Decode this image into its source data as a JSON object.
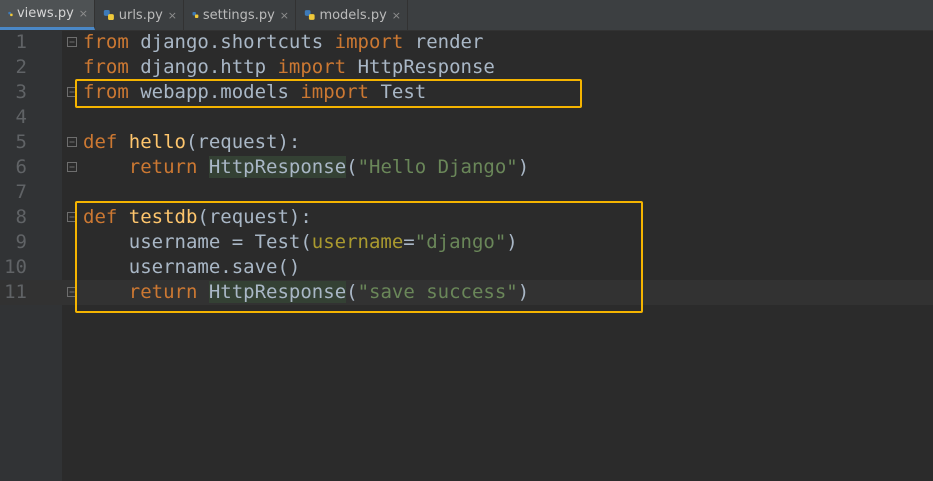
{
  "tabs": [
    {
      "label": "views.py",
      "active": true,
      "closable": true
    },
    {
      "label": "urls.py",
      "active": false,
      "closable": true
    },
    {
      "label": "settings.py",
      "active": false,
      "closable": true
    },
    {
      "label": "models.py",
      "active": false,
      "closable": true
    }
  ],
  "close_glyph": "×",
  "line_numbers": [
    "1",
    "2",
    "3",
    "4",
    "5",
    "6",
    "7",
    "8",
    "9",
    "10",
    "11"
  ],
  "code": {
    "l1": {
      "kw1": "from",
      "t1": " django.shortcuts ",
      "kw2": "import",
      "t2": " render"
    },
    "l2": {
      "kw1": "from",
      "t1": " django.http ",
      "kw2": "import",
      "t2": " HttpResponse"
    },
    "l3": {
      "kw1": "from",
      "t1": " webapp.models ",
      "kw2": "import",
      "t2": " Test"
    },
    "l5": {
      "kw": "def",
      "sp": " ",
      "fn": "hello",
      "rest": "(request):"
    },
    "l6": {
      "indent": "    ",
      "kw": "return",
      "sp": " ",
      "cls": "HttpResponse",
      "p1": "(",
      "str": "\"Hello Django\"",
      "p2": ")"
    },
    "l8": {
      "kw": "def",
      "sp": " ",
      "fn": "testdb",
      "rest": "(request):"
    },
    "l9": {
      "t1": "    username = Test(",
      "param": "username",
      "eq": "=",
      "str": "\"django\"",
      "p2": ")"
    },
    "l10": {
      "t1": "    username.save()"
    },
    "l11": {
      "indent": "    ",
      "kw": "return",
      "sp": " ",
      "cls": "HttpResponse",
      "p1": "(",
      "str": "\"save success\"",
      "p2": ")"
    }
  },
  "colors": {
    "keyword": "#cc7832",
    "function": "#ffc66d",
    "string": "#6a8759",
    "parameter": "#aa9a2f",
    "highlight_box": "#f5b400"
  }
}
